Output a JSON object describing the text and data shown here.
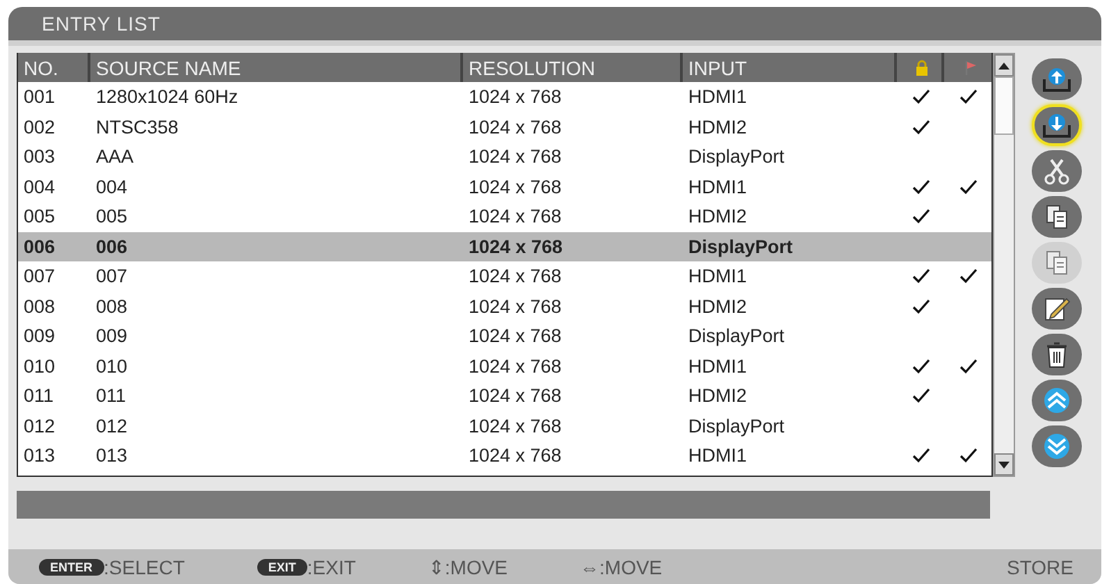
{
  "window": {
    "title": "ENTRY LIST"
  },
  "table": {
    "columns": [
      "NO.",
      "SOURCE NAME",
      "RESOLUTION",
      "INPUT"
    ],
    "rows": [
      {
        "no": "001",
        "name": "1280x1024 60Hz",
        "resolution": "1024 x 768",
        "input": "HDMI1",
        "locked": true,
        "marked": true,
        "selected": false
      },
      {
        "no": "002",
        "name": "NTSC358",
        "resolution": "1024 x 768",
        "input": "HDMI2",
        "locked": true,
        "marked": false,
        "selected": false
      },
      {
        "no": "003",
        "name": "AAA",
        "resolution": "1024 x 768",
        "input": "DisplayPort",
        "locked": false,
        "marked": false,
        "selected": false
      },
      {
        "no": "004",
        "name": "004",
        "resolution": "1024 x 768",
        "input": "HDMI1",
        "locked": true,
        "marked": true,
        "selected": false
      },
      {
        "no": "005",
        "name": "005",
        "resolution": "1024 x 768",
        "input": "HDMI2",
        "locked": true,
        "marked": false,
        "selected": false
      },
      {
        "no": "006",
        "name": "006",
        "resolution": "1024 x 768",
        "input": "DisplayPort",
        "locked": false,
        "marked": false,
        "selected": true
      },
      {
        "no": "007",
        "name": "007",
        "resolution": "1024 x 768",
        "input": "HDMI1",
        "locked": true,
        "marked": true,
        "selected": false
      },
      {
        "no": "008",
        "name": "008",
        "resolution": "1024 x 768",
        "input": "HDMI2",
        "locked": true,
        "marked": false,
        "selected": false
      },
      {
        "no": "009",
        "name": "009",
        "resolution": "1024 x 768",
        "input": "DisplayPort",
        "locked": false,
        "marked": false,
        "selected": false
      },
      {
        "no": "010",
        "name": "010",
        "resolution": "1024 x 768",
        "input": "HDMI1",
        "locked": true,
        "marked": true,
        "selected": false
      },
      {
        "no": "011",
        "name": "011",
        "resolution": "1024 x 768",
        "input": "HDMI2",
        "locked": true,
        "marked": false,
        "selected": false
      },
      {
        "no": "012",
        "name": "012",
        "resolution": "1024 x 768",
        "input": "DisplayPort",
        "locked": false,
        "marked": false,
        "selected": false
      },
      {
        "no": "013",
        "name": "013",
        "resolution": "1024 x 768",
        "input": "HDMI1",
        "locked": true,
        "marked": true,
        "selected": false
      }
    ]
  },
  "tools": [
    {
      "kind": "load",
      "selected": false,
      "disabled": false
    },
    {
      "kind": "store",
      "selected": true,
      "disabled": false
    },
    {
      "kind": "cut",
      "selected": false,
      "disabled": false
    },
    {
      "kind": "copy",
      "selected": false,
      "disabled": false
    },
    {
      "kind": "paste",
      "selected": false,
      "disabled": true
    },
    {
      "kind": "edit",
      "selected": false,
      "disabled": false
    },
    {
      "kind": "delete",
      "selected": false,
      "disabled": false
    },
    {
      "kind": "up",
      "selected": false,
      "disabled": false
    },
    {
      "kind": "down",
      "selected": false,
      "disabled": false
    }
  ],
  "footer": {
    "hints": [
      {
        "key": "ENTER",
        "label": ":SELECT"
      },
      {
        "key": "EXIT",
        "label": ":EXIT"
      },
      {
        "label": "⇕:MOVE"
      },
      {
        "label": "⇔:MOVE"
      }
    ],
    "action": "STORE"
  }
}
